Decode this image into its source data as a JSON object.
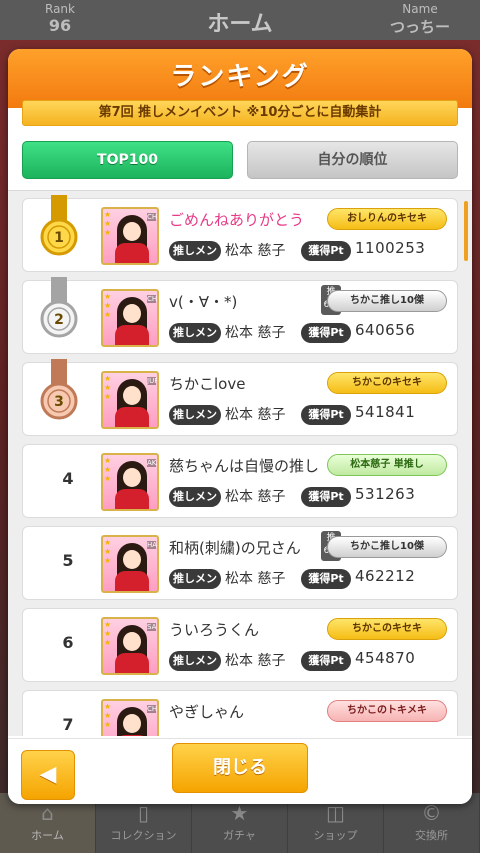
{
  "background": {
    "rank_label": "Rank",
    "rank_value": "96",
    "title": "ホーム",
    "name_label": "Name",
    "name_value": "つっちー",
    "nav": [
      {
        "label": "ホーム",
        "icon": "home-icon"
      },
      {
        "label": "コレクション",
        "icon": "collection-icon"
      },
      {
        "label": "ガチャ",
        "icon": "gacha-icon"
      },
      {
        "label": "ショップ",
        "icon": "shop-icon"
      },
      {
        "label": "交換所",
        "icon": "exchange-icon"
      }
    ]
  },
  "dialog": {
    "title": "ランキング",
    "event": "第7回 推しメンイベント ※10分ごとに自動集計",
    "tabs": {
      "top": "TOP100",
      "mine": "自分の順位"
    },
    "oshi_label": "推しメン",
    "pt_label": "獲得Pt",
    "oshi_tag": "推\n6回",
    "close_label": "閉じる",
    "back_label": "◀"
  },
  "rows": [
    {
      "rank": "1",
      "name": "ごめんねありがとう",
      "oshi": "松本 慈子",
      "pt": "1100253",
      "badge": "おしりんのキセキ",
      "side": "CHIKAKO"
    },
    {
      "rank": "2",
      "name": "v(・∀・*)",
      "oshi": "松本 慈子",
      "pt": "640656",
      "badge": "ちかこ推し10傑",
      "side": "CHIKAKO"
    },
    {
      "rank": "3",
      "name": "ちかこlove",
      "oshi": "松本 慈子",
      "pt": "541841",
      "badge": "ちかこのキセキ",
      "side": "JURINA"
    },
    {
      "rank": "4",
      "name": "慈ちゃんは自慢の推し",
      "oshi": "松本 慈子",
      "pt": "531263",
      "badge": "松本慈子 単推し",
      "side": "AKARI"
    },
    {
      "rank": "5",
      "name": "和柄(刺繍)の兄さん",
      "oshi": "松本 慈子",
      "pt": "462212",
      "badge": "ちかこ推し10傑",
      "side": "HARUKA"
    },
    {
      "rank": "6",
      "name": "ういろうくん",
      "oshi": "松本 慈子",
      "pt": "454870",
      "badge": "ちかこのキセキ",
      "side": "SAKI"
    },
    {
      "rank": "7",
      "name": "やぎしゃん",
      "oshi": "",
      "pt": "",
      "badge": "ちかこのトキメキ",
      "side": "CHI"
    }
  ]
}
